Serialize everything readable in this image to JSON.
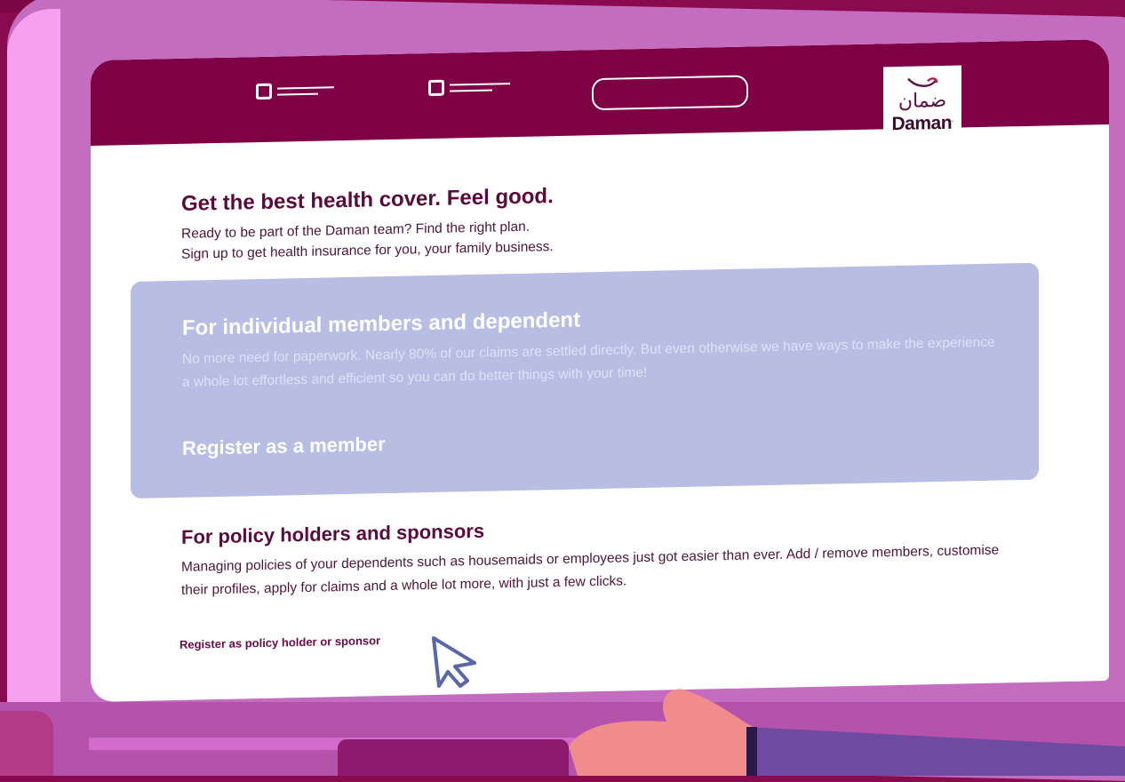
{
  "nav": {
    "search_placeholder": ""
  },
  "logo": {
    "arabic": "ضمان",
    "latin": "Daman",
    "mark": ".",
    "brand_color": "#7e0145"
  },
  "hero": {
    "title": "Get the best health cover. Feel good.",
    "line1": "Ready to be part of the Daman team? Find the right plan.",
    "line2": "Sign up to get health insurance for you, your family business."
  },
  "individual_card": {
    "title": "For individual members and dependent",
    "description": "No more need for paperwork. Nearly 80% of our claims are settled directly. But even otherwise we have ways to make the experience a whole lot effortless and efficient so you can do better things with your time!",
    "link": "Register as a member",
    "bg_color": "#b7bde3"
  },
  "policy_section": {
    "title": "For policy holders and sponsors",
    "description": "Managing policies of your dependents such as housemaids or employees just got easier than ever. Add / remove members, customise their profiles, apply for claims and a whole lot more, with just a few clicks.",
    "cta": "Register as policy holder or sponsor"
  },
  "icons": [
    "menu-item-icon",
    "menu-item-icon",
    "search-box-icon",
    "daman-logo-icon",
    "mouse-cursor-icon"
  ]
}
